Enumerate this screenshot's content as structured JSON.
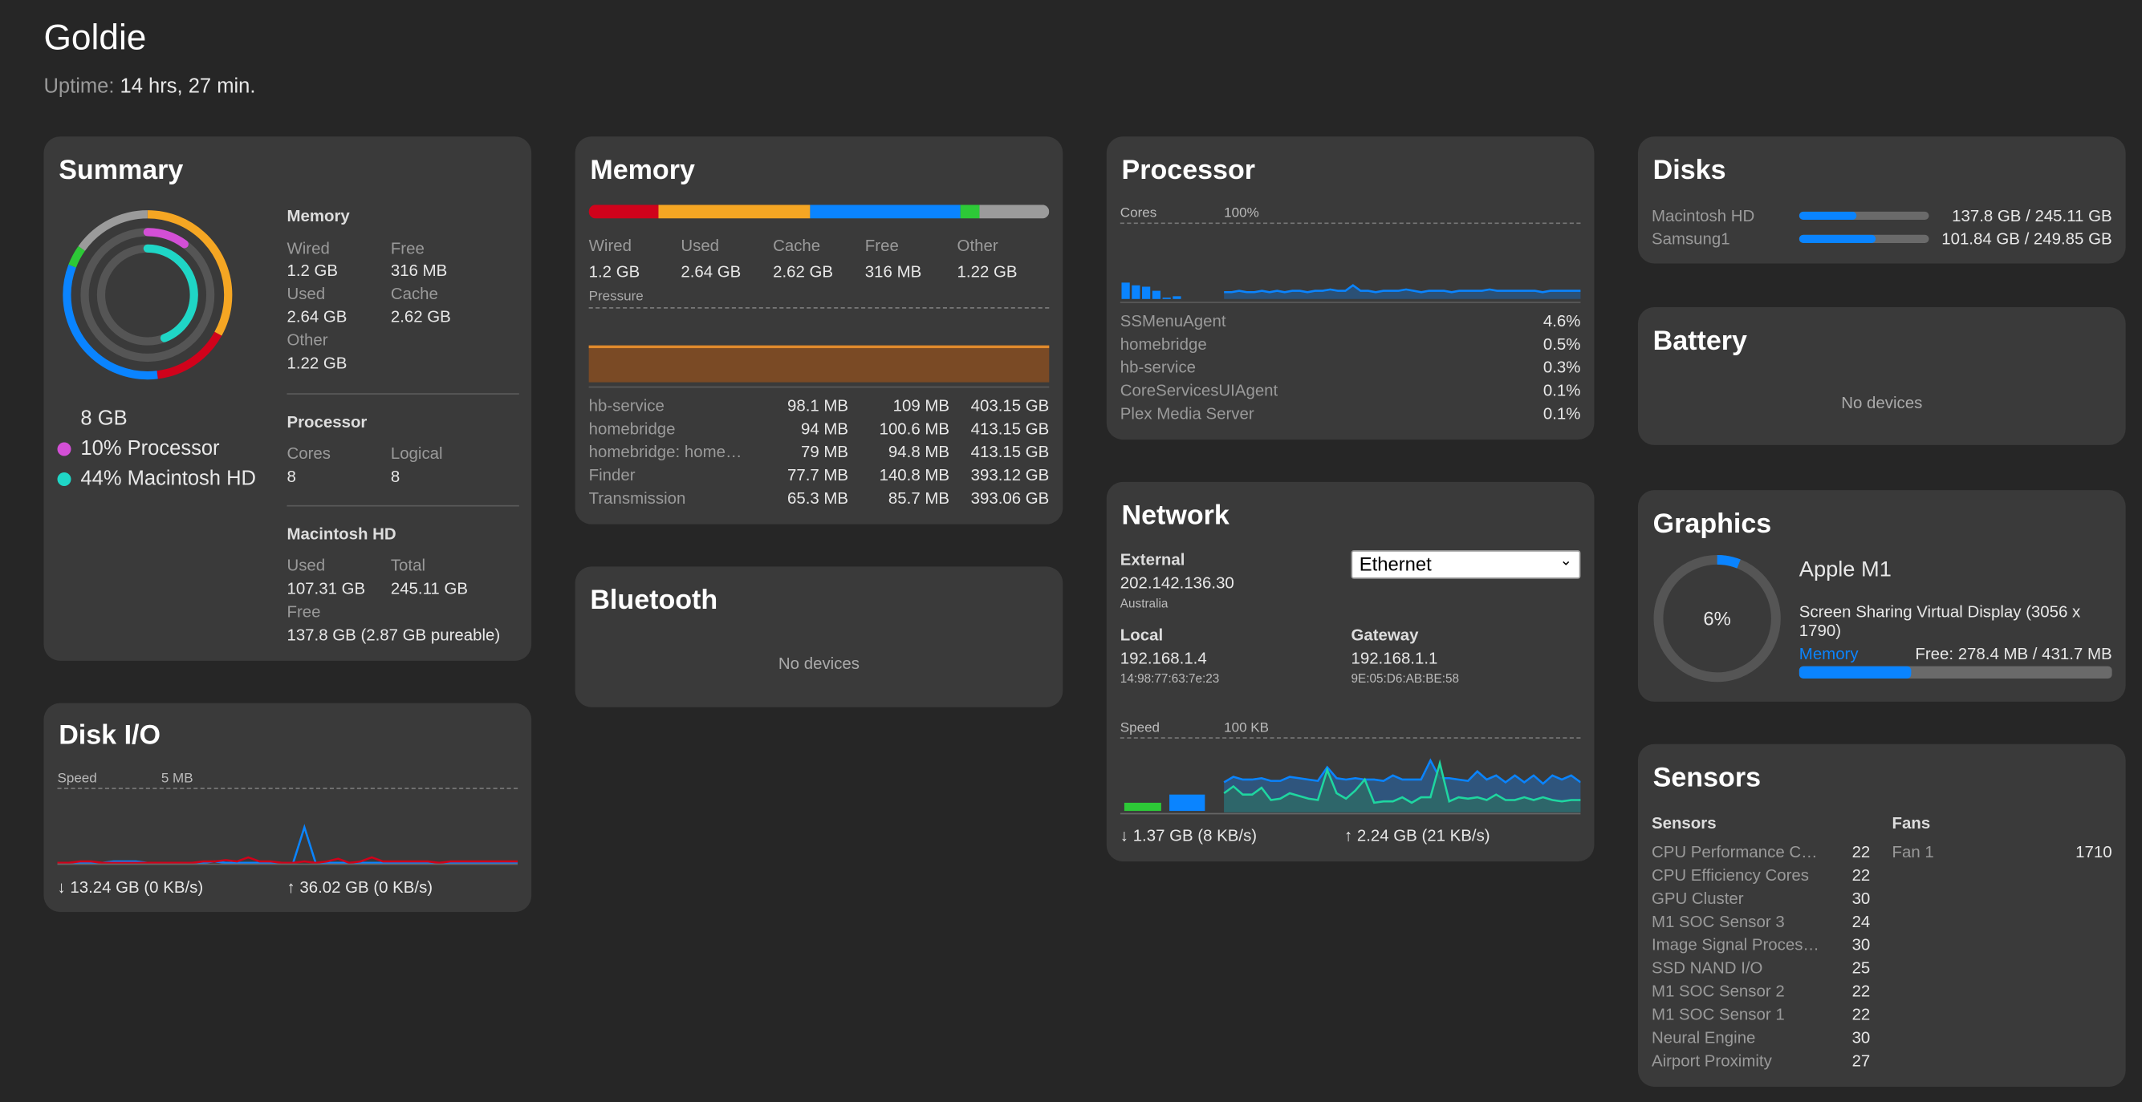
{
  "host": {
    "name": "Goldie",
    "uptime_label": "Uptime:",
    "uptime": "14 hrs, 27 min."
  },
  "colors": {
    "wired": "#d0021b",
    "used": "#f5a623",
    "cache": "#0a84ff",
    "free": "#2dc937",
    "other": "#9b9b9b",
    "processor": "#d34fd6",
    "disk": "#1fd6c6"
  },
  "summary": {
    "title": "Summary",
    "total": "8 GB",
    "processor_legend": "10% Processor",
    "disk_legend": "44% Macintosh HD",
    "processor_pct": 10,
    "disk_pct": 44,
    "memory": {
      "title": "Memory",
      "wired_l": "Wired",
      "wired": "1.2 GB",
      "free_l": "Free",
      "free": "316 MB",
      "used_l": "Used",
      "used": "2.64 GB",
      "cache_l": "Cache",
      "cache": "2.62 GB",
      "other_l": "Other",
      "other": "1.22 GB"
    },
    "processor": {
      "title": "Processor",
      "cores_l": "Cores",
      "cores": "8",
      "logical_l": "Logical",
      "logical": "8"
    },
    "disk": {
      "title": "Macintosh HD",
      "used_l": "Used",
      "used": "107.31 GB",
      "total_l": "Total",
      "total": "245.11 GB",
      "free_l": "Free",
      "free": "137.8 GB (2.87 GB pureable)"
    }
  },
  "memory": {
    "title": "Memory",
    "segments": [
      {
        "label": "Wired",
        "value": "1.2 GB",
        "gb": 1.2
      },
      {
        "label": "Used",
        "value": "2.64 GB",
        "gb": 2.64
      },
      {
        "label": "Cache",
        "value": "2.62 GB",
        "gb": 2.62
      },
      {
        "label": "Free",
        "value": "316 MB",
        "gb": 0.316
      },
      {
        "label": "Other",
        "value": "1.22 GB",
        "gb": 1.22
      }
    ],
    "pressure_label": "Pressure",
    "processes": [
      [
        "hb-service",
        "98.1 MB",
        "109 MB",
        "403.15 GB"
      ],
      [
        "homebridge",
        "94 MB",
        "100.6 MB",
        "413.15 GB"
      ],
      [
        "homebridge: home…",
        "79 MB",
        "94.8 MB",
        "413.15 GB"
      ],
      [
        "Finder",
        "77.7 MB",
        "140.8 MB",
        "393.12 GB"
      ],
      [
        "Transmission",
        "65.3 MB",
        "85.7 MB",
        "393.06 GB"
      ]
    ]
  },
  "bluetooth": {
    "title": "Bluetooth",
    "empty": "No devices"
  },
  "processor": {
    "title": "Processor",
    "cores_label": "Cores",
    "scale_label": "100%",
    "processes": [
      [
        "SSMenuAgent",
        "4.6%"
      ],
      [
        "homebridge",
        "0.5%"
      ],
      [
        "hb-service",
        "0.3%"
      ],
      [
        "CoreServicesUIAgent",
        "0.1%"
      ],
      [
        "Plex Media Server",
        "0.1%"
      ]
    ],
    "core_bars": [
      12,
      10,
      9,
      6,
      1,
      2
    ],
    "history": [
      5,
      5,
      6,
      5,
      5,
      6,
      5,
      6,
      5,
      6,
      6,
      5,
      6,
      6,
      7,
      6,
      6,
      10,
      6,
      6,
      5,
      6,
      6,
      6,
      7,
      6,
      5,
      6,
      6,
      6,
      5,
      6,
      6,
      6,
      6,
      7,
      6,
      6,
      6,
      6,
      6,
      6,
      5,
      6,
      6,
      6,
      6,
      6
    ]
  },
  "network": {
    "title": "Network",
    "external_l": "External",
    "external_ip": "202.142.136.30",
    "country": "Australia",
    "interface": "Ethernet",
    "local_l": "Local",
    "local_ip": "192.168.1.4",
    "local_mac": "14:98:77:63:7e:23",
    "gateway_l": "Gateway",
    "gateway_ip": "192.168.1.1",
    "gateway_mac": "9E:05:D6:AB:BE:58",
    "speed_label": "Speed",
    "scale_label": "100 KB",
    "down": "↓ 1.37 GB (8 KB/s)",
    "up": "↑ 2.24 GB (21 KB/s)",
    "upload_series": [
      22,
      26,
      24,
      24,
      25,
      23,
      23,
      26,
      25,
      24,
      23,
      33,
      25,
      24,
      25,
      24,
      24,
      23,
      27,
      24,
      24,
      24,
      38,
      25,
      25,
      24,
      23,
      30,
      24,
      27,
      22,
      27,
      22,
      27,
      21,
      27,
      24,
      27,
      22
    ],
    "download_series": [
      14,
      19,
      13,
      13,
      18,
      9,
      10,
      14,
      12,
      10,
      9,
      31,
      14,
      10,
      16,
      24,
      7,
      8,
      8,
      11,
      7,
      11,
      11,
      36,
      8,
      11,
      10,
      11,
      9,
      13,
      9,
      9,
      11,
      9,
      11,
      9,
      8,
      9,
      9
    ]
  },
  "disk_io": {
    "title": "Disk I/O",
    "speed_label": "Speed",
    "scale_label": "5 MB",
    "read": "↓ 13.24 GB (0 KB/s)",
    "write": "↑ 36.02 GB (0 KB/s)",
    "read_series": [
      1,
      1,
      1,
      1,
      1,
      2,
      2,
      2,
      1,
      1,
      1,
      1,
      1,
      1,
      2,
      1,
      1,
      1,
      1,
      1,
      1,
      1,
      2,
      1,
      1,
      1,
      1,
      1,
      1,
      1,
      1,
      1,
      1,
      1,
      1,
      1,
      1,
      1,
      1,
      1,
      1,
      1
    ],
    "write_series": [
      1,
      1,
      2,
      2,
      1,
      1,
      1,
      1,
      1,
      1,
      1,
      1,
      1,
      2,
      2,
      3,
      2,
      5,
      2,
      2,
      1,
      1,
      2,
      1,
      2,
      4,
      1,
      2,
      5,
      2,
      2,
      2,
      2,
      2,
      1,
      2,
      2,
      2,
      2,
      2,
      2,
      2
    ],
    "blue_spike": [
      0,
      0,
      0,
      0,
      0,
      0,
      0,
      0,
      0,
      0,
      0,
      0,
      0,
      0,
      0,
      0,
      0,
      0,
      0,
      0,
      0,
      0,
      0,
      0,
      0,
      0,
      0,
      0,
      0,
      0,
      0,
      0,
      0,
      0,
      0,
      0,
      0,
      0,
      0,
      0,
      0,
      0
    ]
  },
  "disks": {
    "title": "Disks",
    "items": [
      {
        "name": "Macintosh HD",
        "value": "137.8 GB / 245.11 GB",
        "pct": 44
      },
      {
        "name": "Samsung1",
        "value": "101.84 GB / 249.85 GB",
        "pct": 59
      }
    ]
  },
  "battery": {
    "title": "Battery",
    "empty": "No devices"
  },
  "graphics": {
    "title": "Graphics",
    "gpu": "Apple M1",
    "usage": "6%",
    "usage_pct": 6,
    "display": "Screen Sharing Virtual Display (3056 x 1790)",
    "memory_l": "Memory",
    "memory": "Free: 278.4 MB / 431.7 MB",
    "memory_used_pct": 36
  },
  "sensors": {
    "title": "Sensors",
    "sensors_l": "Sensors",
    "fans_l": "Fans",
    "items": [
      [
        "CPU Performance C…",
        "22"
      ],
      [
        "CPU Efficiency Cores",
        "22"
      ],
      [
        "GPU Cluster",
        "30"
      ],
      [
        "M1 SOC Sensor 3",
        "24"
      ],
      [
        "Image Signal Proces…",
        "30"
      ],
      [
        "SSD NAND I/O",
        "25"
      ],
      [
        "M1 SOC Sensor 2",
        "22"
      ],
      [
        "M1 SOC Sensor 1",
        "22"
      ],
      [
        "Neural Engine",
        "30"
      ],
      [
        "Airport Proximity",
        "27"
      ]
    ],
    "fans": [
      [
        "Fan 1",
        "1710"
      ]
    ]
  }
}
